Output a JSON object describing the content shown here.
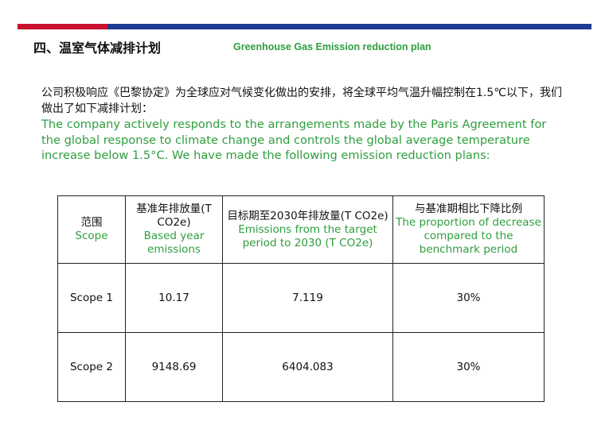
{
  "header": {
    "title_zh": "四、温室气体减排计划",
    "title_en": "Greenhouse Gas Emission reduction plan",
    "colors": {
      "red": "#c8102e",
      "blue": "#1f3a93",
      "green": "#2e9e3e"
    }
  },
  "intro": {
    "zh": "公司积极响应《巴黎协定》为全球应对气候变化做出的安排，将全球平均气温升幅控制在1.5℃以下，我们做出了如下减排计划：",
    "en": "The company actively responds to the arrangements made by the Paris Agreement for the global response to climate change and controls the global average temperature increase below 1.5°C. We have made the following emission reduction plans:"
  },
  "table": {
    "columns": [
      {
        "zh": "范围",
        "en": "Scope"
      },
      {
        "zh": "基准年排放量(T CO2e)",
        "en": "Based year emissions"
      },
      {
        "zh": "目标期至2030年排放量(T CO2e)",
        "en": "Emissions from the target period to 2030 (T CO2e)"
      },
      {
        "zh": "与基准期相比下降比例",
        "en": "The proportion of decrease compared to the benchmark period"
      }
    ],
    "rows": [
      {
        "scope": "Scope 1",
        "base": "10.17",
        "target": "7.119",
        "decrease": "30%"
      },
      {
        "scope": "Scope 2",
        "base": "9148.69",
        "target": "6404.083",
        "decrease": "30%"
      }
    ]
  }
}
